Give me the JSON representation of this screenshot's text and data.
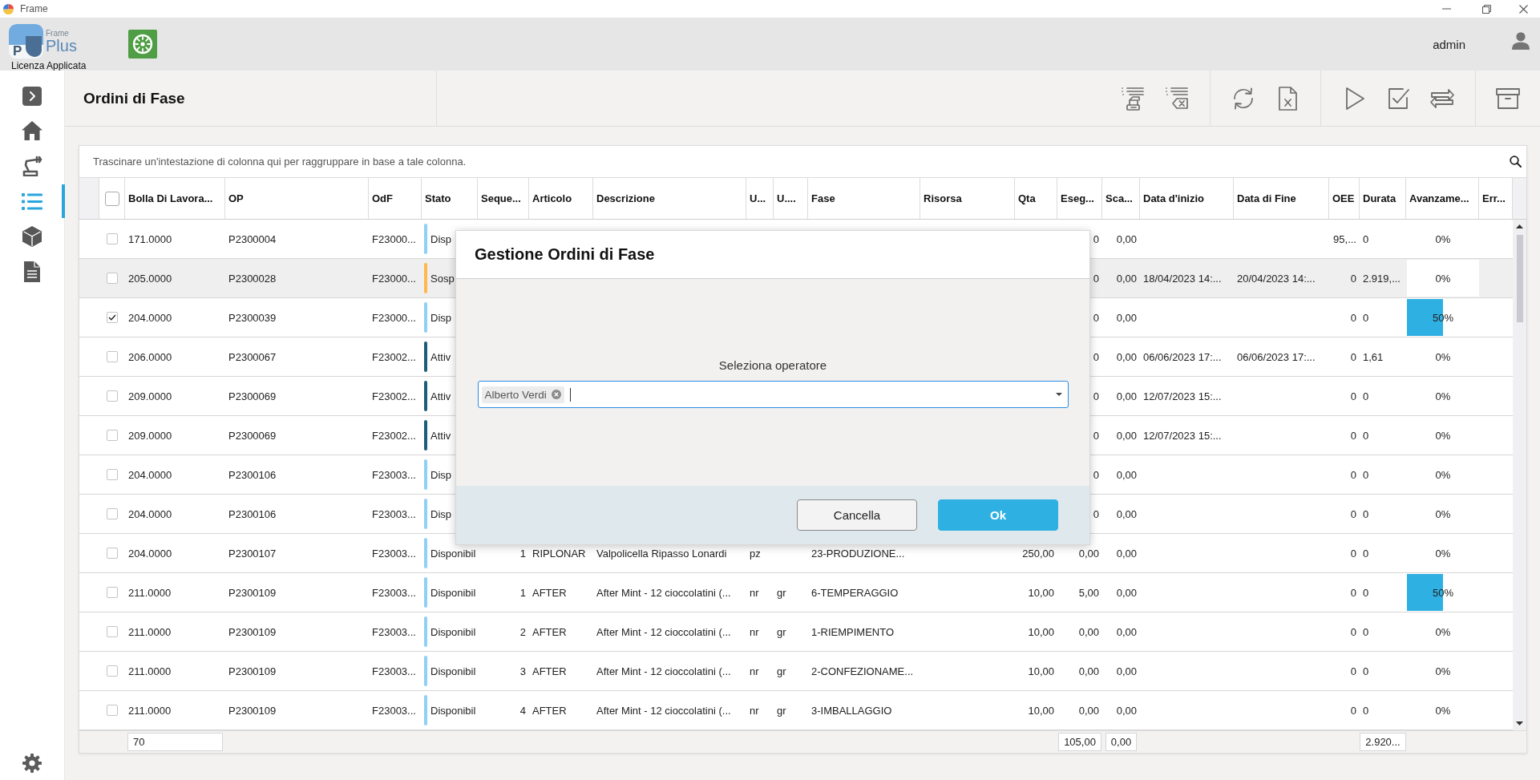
{
  "window": {
    "title": "Frame"
  },
  "header": {
    "logo": {
      "letter": "P",
      "small": "Frame",
      "name": "Plus"
    },
    "license": "Licenza Applicata",
    "user": "admin"
  },
  "sidebar": {
    "items": [
      {
        "selected": false
      },
      {
        "selected": false
      },
      {
        "selected": true
      },
      {
        "selected": false
      },
      {
        "selected": false
      }
    ]
  },
  "page": {
    "title": "Ordini di Fase"
  },
  "table": {
    "group_hint": "Trascinare un'intestazione di colonna qui per raggruppare in base a tale colonna.",
    "select_all": false,
    "columns": [
      "Bolla Di Lavora...",
      "OP",
      "OdF",
      "Stato",
      "Seque...",
      "Articolo",
      "Descrizione",
      "U...",
      "U....",
      "Fase",
      "Risorsa",
      "Qta",
      "Eseg...",
      "Sca...",
      "Data d'inizio",
      "Data di Fine",
      "OEE",
      "Durata",
      "Avanzame...",
      "Err..."
    ],
    "rows": [
      {
        "checked": false,
        "highlighted": false,
        "bolla": "171.0000",
        "op": "P2300004",
        "odf": "F23000...",
        "status": {
          "text": "Disp",
          "color": "#8fd0f7"
        },
        "eseguita": "0",
        "scarto": "0,00",
        "oee": "95,...",
        "durata": "0",
        "avanzamento": {
          "level": 0,
          "label": "0%"
        }
      },
      {
        "checked": false,
        "highlighted": true,
        "bolla": "205.0000",
        "op": "P2300028",
        "odf": "F23000...",
        "status": {
          "text": "Sosp",
          "color": "#ffb84d"
        },
        "eseguita": "0",
        "scarto": "0,00",
        "data_inizio": "18/04/2023 14:...",
        "data_fine": "20/04/2023 14:...",
        "oee": "0",
        "durata": "2.919,...",
        "avanzamento": {
          "level": 0,
          "label": "0%"
        }
      },
      {
        "checked": true,
        "highlighted": false,
        "bolla": "204.0000",
        "op": "P2300039",
        "odf": "F23000...",
        "status": {
          "text": "Disp",
          "color": "#8fd0f7"
        },
        "eseguita": "0",
        "scarto": "0,00",
        "oee": "0",
        "durata": "0",
        "avanzamento": {
          "level": 0.5,
          "label": "50%"
        }
      },
      {
        "checked": false,
        "highlighted": false,
        "bolla": "206.0000",
        "op": "P2300067",
        "odf": "F23002...",
        "status": {
          "text": "Attiv",
          "color": "#1c5d7a"
        },
        "eseguita": "0",
        "scarto": "0,00",
        "data_inizio": "06/06/2023 17:...",
        "data_fine": "06/06/2023 17:...",
        "oee": "0",
        "durata": "1,61",
        "avanzamento": {
          "level": 0,
          "label": "0%"
        }
      },
      {
        "checked": false,
        "highlighted": false,
        "bolla": "209.0000",
        "op": "P2300069",
        "odf": "F23002...",
        "status": {
          "text": "Attiv",
          "color": "#1c5d7a"
        },
        "eseguita": "0",
        "scarto": "0,00",
        "data_inizio": "12/07/2023 15:...",
        "oee": "0",
        "durata": "0",
        "avanzamento": {
          "level": 0,
          "label": "0%"
        }
      },
      {
        "checked": false,
        "highlighted": false,
        "bolla": "209.0000",
        "op": "P2300069",
        "odf": "F23002...",
        "status": {
          "text": "Attiv",
          "color": "#1c5d7a"
        },
        "eseguita": "0",
        "scarto": "0,00",
        "data_inizio": "12/07/2023 15:...",
        "oee": "0",
        "durata": "0",
        "avanzamento": {
          "level": 0,
          "label": "0%"
        }
      },
      {
        "checked": false,
        "highlighted": false,
        "bolla": "204.0000",
        "op": "P2300106",
        "odf": "F23003...",
        "status": {
          "text": "Disp",
          "color": "#8fd0f7"
        },
        "eseguita": "0",
        "scarto": "0,00",
        "oee": "0",
        "durata": "0",
        "avanzamento": {
          "level": 0,
          "label": "0%"
        }
      },
      {
        "checked": false,
        "highlighted": false,
        "bolla": "204.0000",
        "op": "P2300106",
        "odf": "F23003...",
        "status": {
          "text": "Disp",
          "color": "#8fd0f7"
        },
        "eseguita": "0",
        "scarto": "0,00",
        "oee": "0",
        "durata": "0",
        "avanzamento": {
          "level": 0,
          "label": "0%"
        }
      },
      {
        "checked": false,
        "highlighted": false,
        "bolla": "204.0000",
        "op": "P2300107",
        "odf": "F23003...",
        "status": {
          "text": "Disponibil",
          "color": "#8fd0f7"
        },
        "sequenza": "1",
        "articolo": "RIPLONAR",
        "descrizione": "Valpolicella Ripasso Lonardi",
        "um": "pz",
        "fase": "23-PRODUZIONE...",
        "qta": "250,00",
        "eseguita": "0,00",
        "scarto": "0,00",
        "oee": "0",
        "durata": "0",
        "avanzamento": {
          "level": 0,
          "label": "0%"
        }
      },
      {
        "checked": false,
        "highlighted": false,
        "bolla": "211.0000",
        "op": "P2300109",
        "odf": "F23003...",
        "status": {
          "text": "Disponibil",
          "color": "#8fd0f7"
        },
        "sequenza": "1",
        "articolo": "AFTER",
        "descrizione": "After Mint - 12 cioccolatini (...",
        "um": "nr",
        "um_2": "gr",
        "fase": "6-TEMPERAGGIO",
        "qta": "10,00",
        "eseguita": "5,00",
        "scarto": "0,00",
        "oee": "0",
        "durata": "0",
        "avanzamento": {
          "level": 0.5,
          "label": "50%"
        }
      },
      {
        "checked": false,
        "highlighted": false,
        "bolla": "211.0000",
        "op": "P2300109",
        "odf": "F23003...",
        "status": {
          "text": "Disponibil",
          "color": "#8fd0f7"
        },
        "sequenza": "2",
        "articolo": "AFTER",
        "descrizione": "After Mint - 12 cioccolatini (...",
        "um": "nr",
        "um_2": "gr",
        "fase": "1-RIEMPIMENTO",
        "qta": "10,00",
        "eseguita": "0,00",
        "scarto": "0,00",
        "oee": "0",
        "durata": "0",
        "avanzamento": {
          "level": 0,
          "label": "0%"
        }
      },
      {
        "checked": false,
        "highlighted": false,
        "bolla": "211.0000",
        "op": "P2300109",
        "odf": "F23003...",
        "status": {
          "text": "Disponibil",
          "color": "#8fd0f7"
        },
        "sequenza": "3",
        "articolo": "AFTER",
        "descrizione": "After Mint - 12 cioccolatini (...",
        "um": "nr",
        "um_2": "gr",
        "fase": "2-CONFEZIONAME...",
        "qta": "10,00",
        "eseguita": "0,00",
        "scarto": "0,00",
        "oee": "0",
        "durata": "0",
        "avanzamento": {
          "level": 0,
          "label": "0%"
        }
      },
      {
        "checked": false,
        "highlighted": false,
        "bolla": "211.0000",
        "op": "P2300109",
        "odf": "F23003...",
        "status": {
          "text": "Disponibil",
          "color": "#8fd0f7"
        },
        "sequenza": "4",
        "articolo": "AFTER",
        "descrizione": "After Mint - 12 cioccolatini (...",
        "um": "nr",
        "um_2": "gr",
        "fase": "3-IMBALLAGGIO",
        "qta": "10,00",
        "eseguita": "0,00",
        "scarto": "0,00",
        "oee": "0",
        "durata": "0",
        "avanzamento": {
          "level": 0,
          "label": "0%"
        }
      }
    ],
    "totals": {
      "bolla": "70",
      "eseguita": "105,00",
      "scarto": "0,00",
      "durata": "2.920..."
    }
  },
  "dialog": {
    "title": "Gestione Ordini di Fase",
    "label": "Seleziona operatore",
    "selected_tags": [
      "Alberto Verdi"
    ],
    "buttons": [
      {
        "label": "Cancella",
        "kind": "secondary"
      },
      {
        "label": "Ok",
        "kind": "primary"
      }
    ]
  }
}
